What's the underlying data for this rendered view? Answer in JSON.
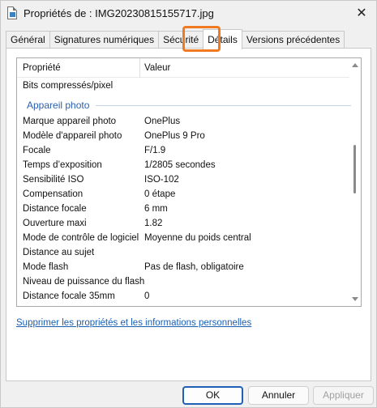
{
  "window": {
    "title": "Propriétés de : IMG20230815155717.jpg",
    "close_glyph": "✕",
    "icon": "image-file-icon"
  },
  "tabs": [
    {
      "label": "Général",
      "active": false
    },
    {
      "label": "Signatures numériques",
      "active": false
    },
    {
      "label": "Sécurité",
      "active": false
    },
    {
      "label": "Détails",
      "active": true
    },
    {
      "label": "Versions précédentes",
      "active": false
    }
  ],
  "highlight_color": "#f07a22",
  "properties": {
    "header": {
      "property": "Propriété",
      "value": "Valeur"
    },
    "pre_group_rows": [
      {
        "key": "Bits compressés/pixel",
        "value": ""
      }
    ],
    "group_title": "Appareil photo",
    "rows": [
      {
        "key": "Marque appareil photo",
        "value": "OnePlus"
      },
      {
        "key": "Modèle d'appareil photo",
        "value": "OnePlus 9 Pro"
      },
      {
        "key": "Focale",
        "value": "F/1.9"
      },
      {
        "key": "Temps d’exposition",
        "value": "1/2805 secondes"
      },
      {
        "key": "Sensibilité ISO",
        "value": "ISO-102"
      },
      {
        "key": "Compensation",
        "value": "0 étape"
      },
      {
        "key": "Distance focale",
        "value": "6 mm"
      },
      {
        "key": "Ouverture maxi",
        "value": "1.82"
      },
      {
        "key": "Mode de contrôle de logiciel",
        "value": "Moyenne du poids central"
      },
      {
        "key": "Distance au sujet",
        "value": ""
      },
      {
        "key": "Mode flash",
        "value": "Pas de flash, obligatoire"
      },
      {
        "key": "Niveau de puissance du flash",
        "value": ""
      },
      {
        "key": "Distance focale 35mm",
        "value": "0"
      }
    ]
  },
  "remove_link": "Supprimer les propriétés et les informations personnelles",
  "buttons": {
    "ok": "OK",
    "cancel": "Annuler",
    "apply": "Appliquer"
  }
}
